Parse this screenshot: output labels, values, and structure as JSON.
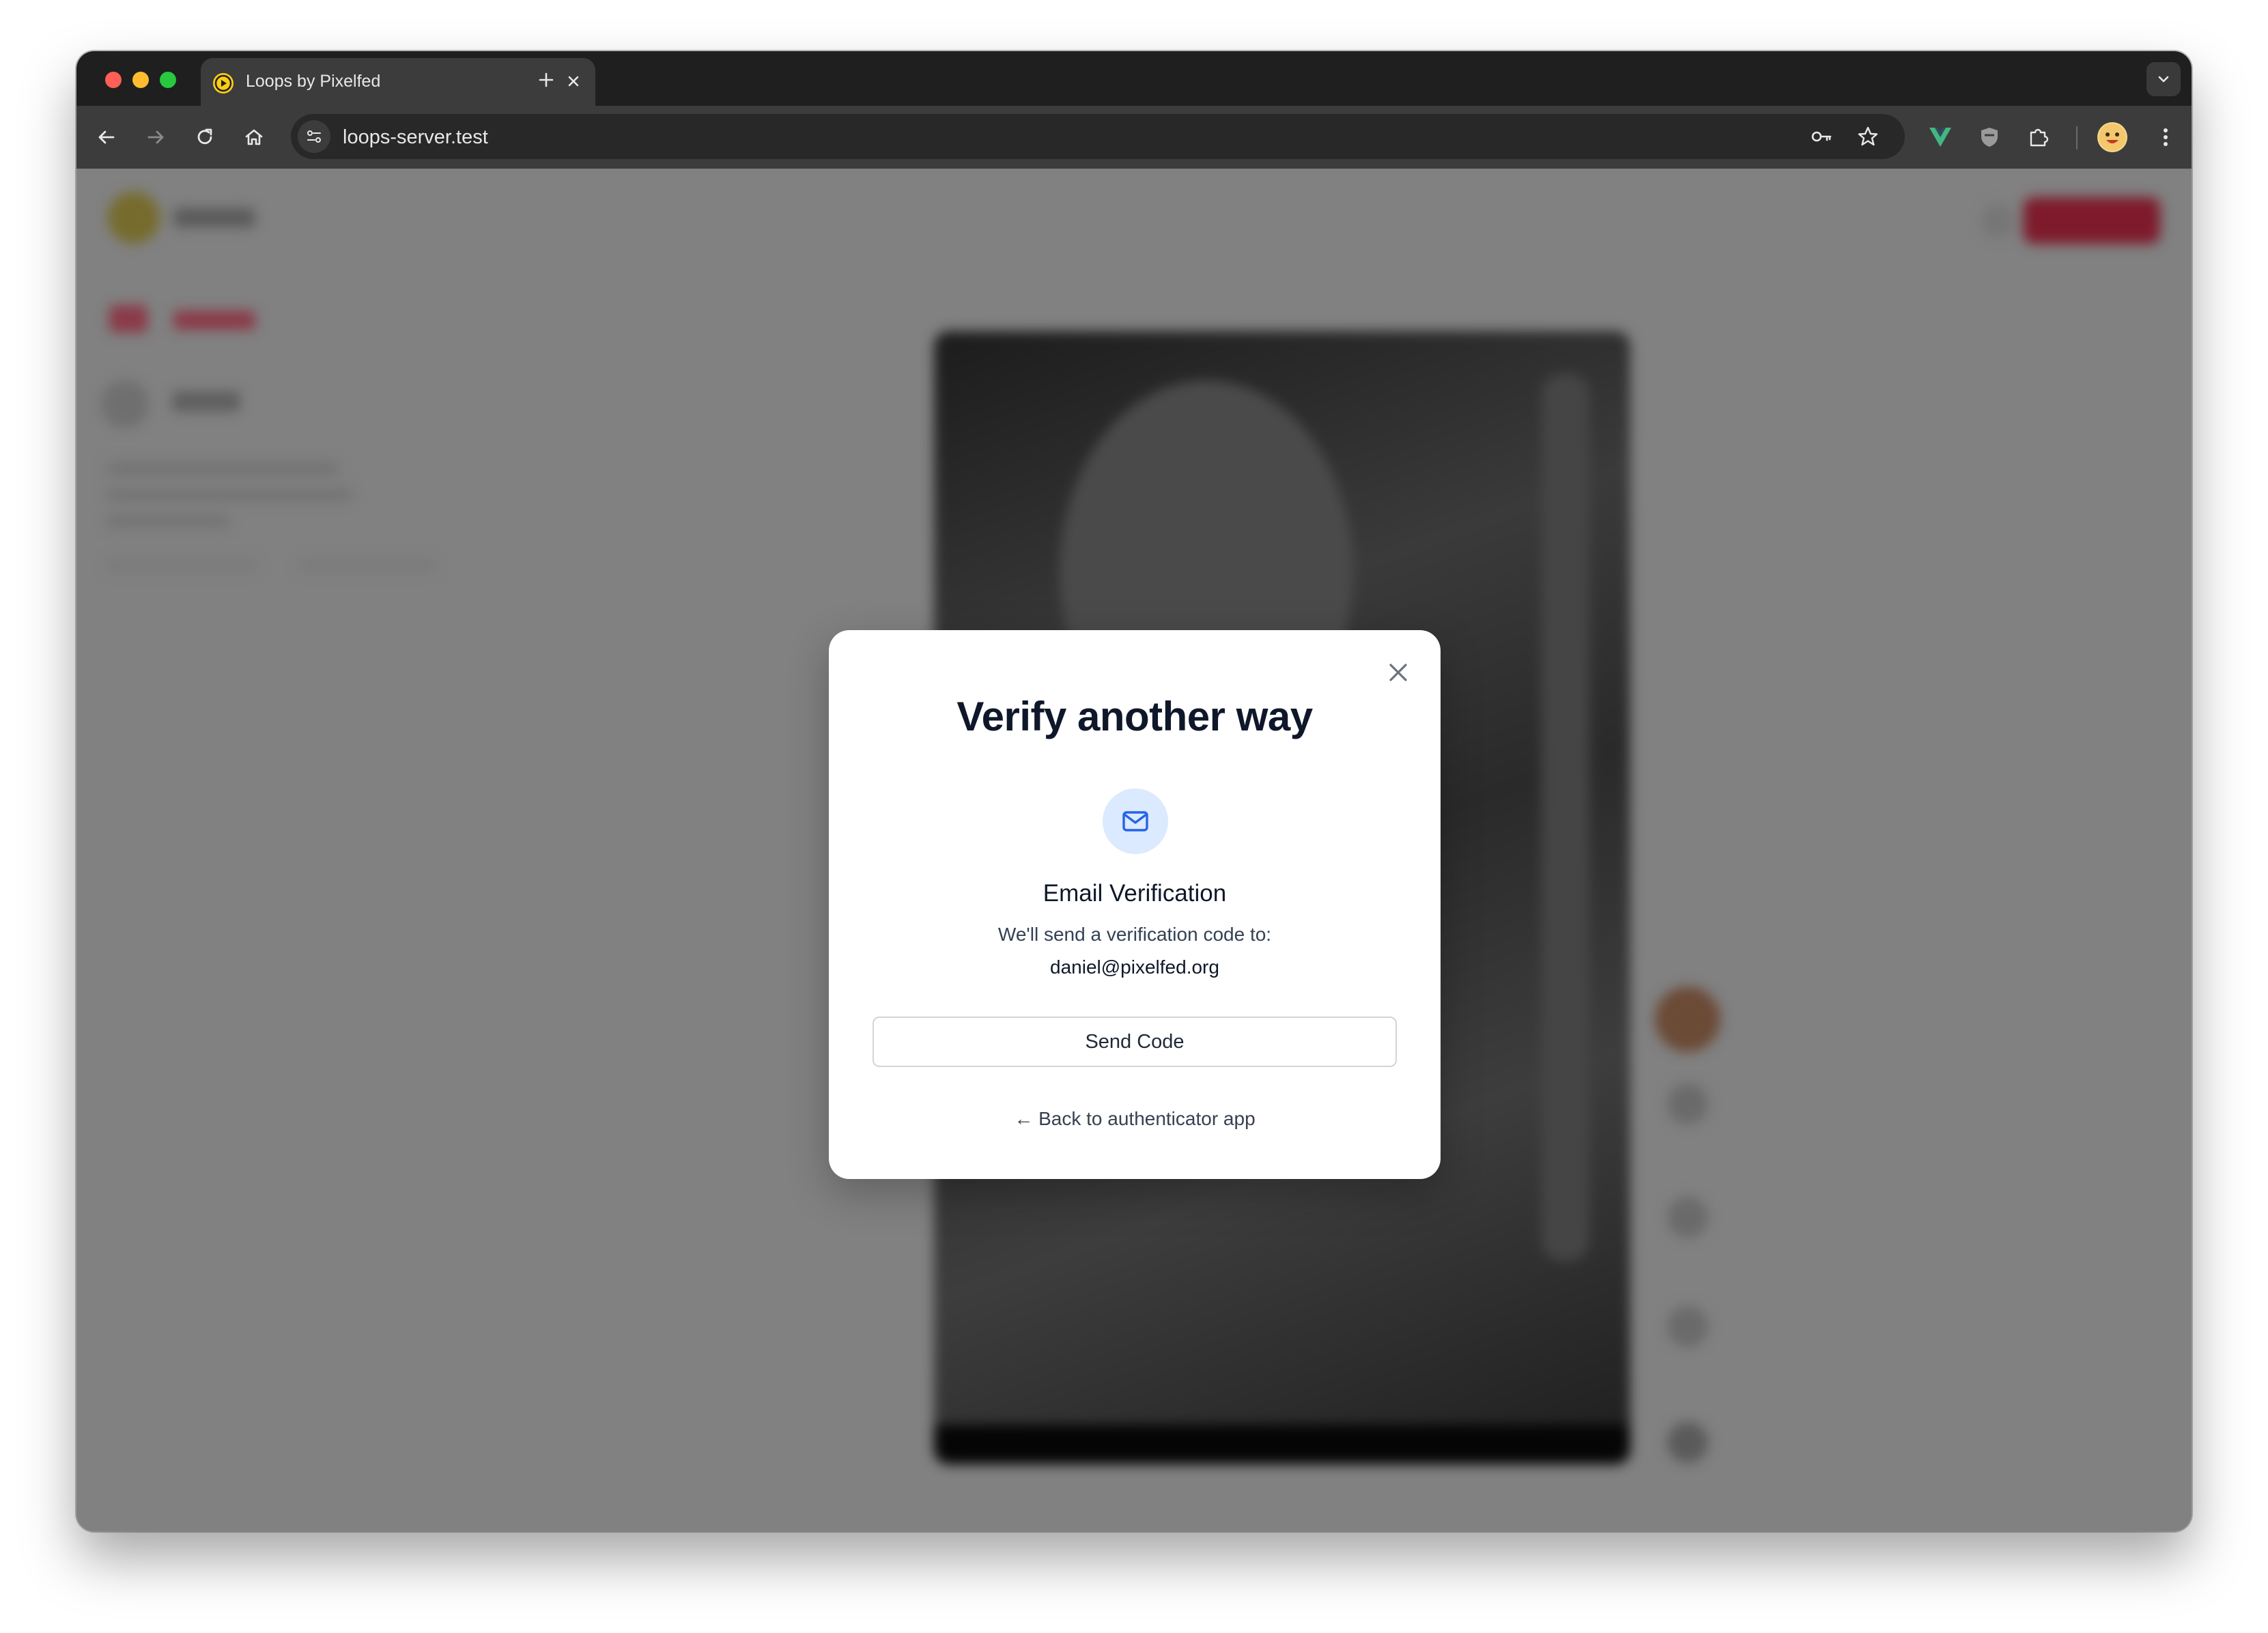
{
  "browser": {
    "tab_title": "Loops by Pixelfed",
    "url": "loops-server.test"
  },
  "modal": {
    "title": "Verify another way",
    "method_title": "Email Verification",
    "description": "We'll send a verification code to:",
    "email": "daniel@pixelfed.org",
    "send_button": "Send Code",
    "back_link": "← Back to authenticator app"
  },
  "colors": {
    "accent_blue": "#2563eb",
    "icon_bg": "#dbeafe",
    "brand_yellow": "#facc15",
    "brand_red": "#e11d48"
  },
  "icons": [
    "loops-favicon-icon",
    "close-icon",
    "plus-icon",
    "chevron-down-icon",
    "back-arrow-icon",
    "forward-arrow-icon",
    "reload-icon",
    "home-icon",
    "site-settings-icon",
    "password-key-icon",
    "bookmark-star-icon",
    "vue-devtools-icon",
    "shield-icon",
    "extensions-icon",
    "profile-avatar",
    "menu-dots-icon",
    "mail-icon"
  ]
}
